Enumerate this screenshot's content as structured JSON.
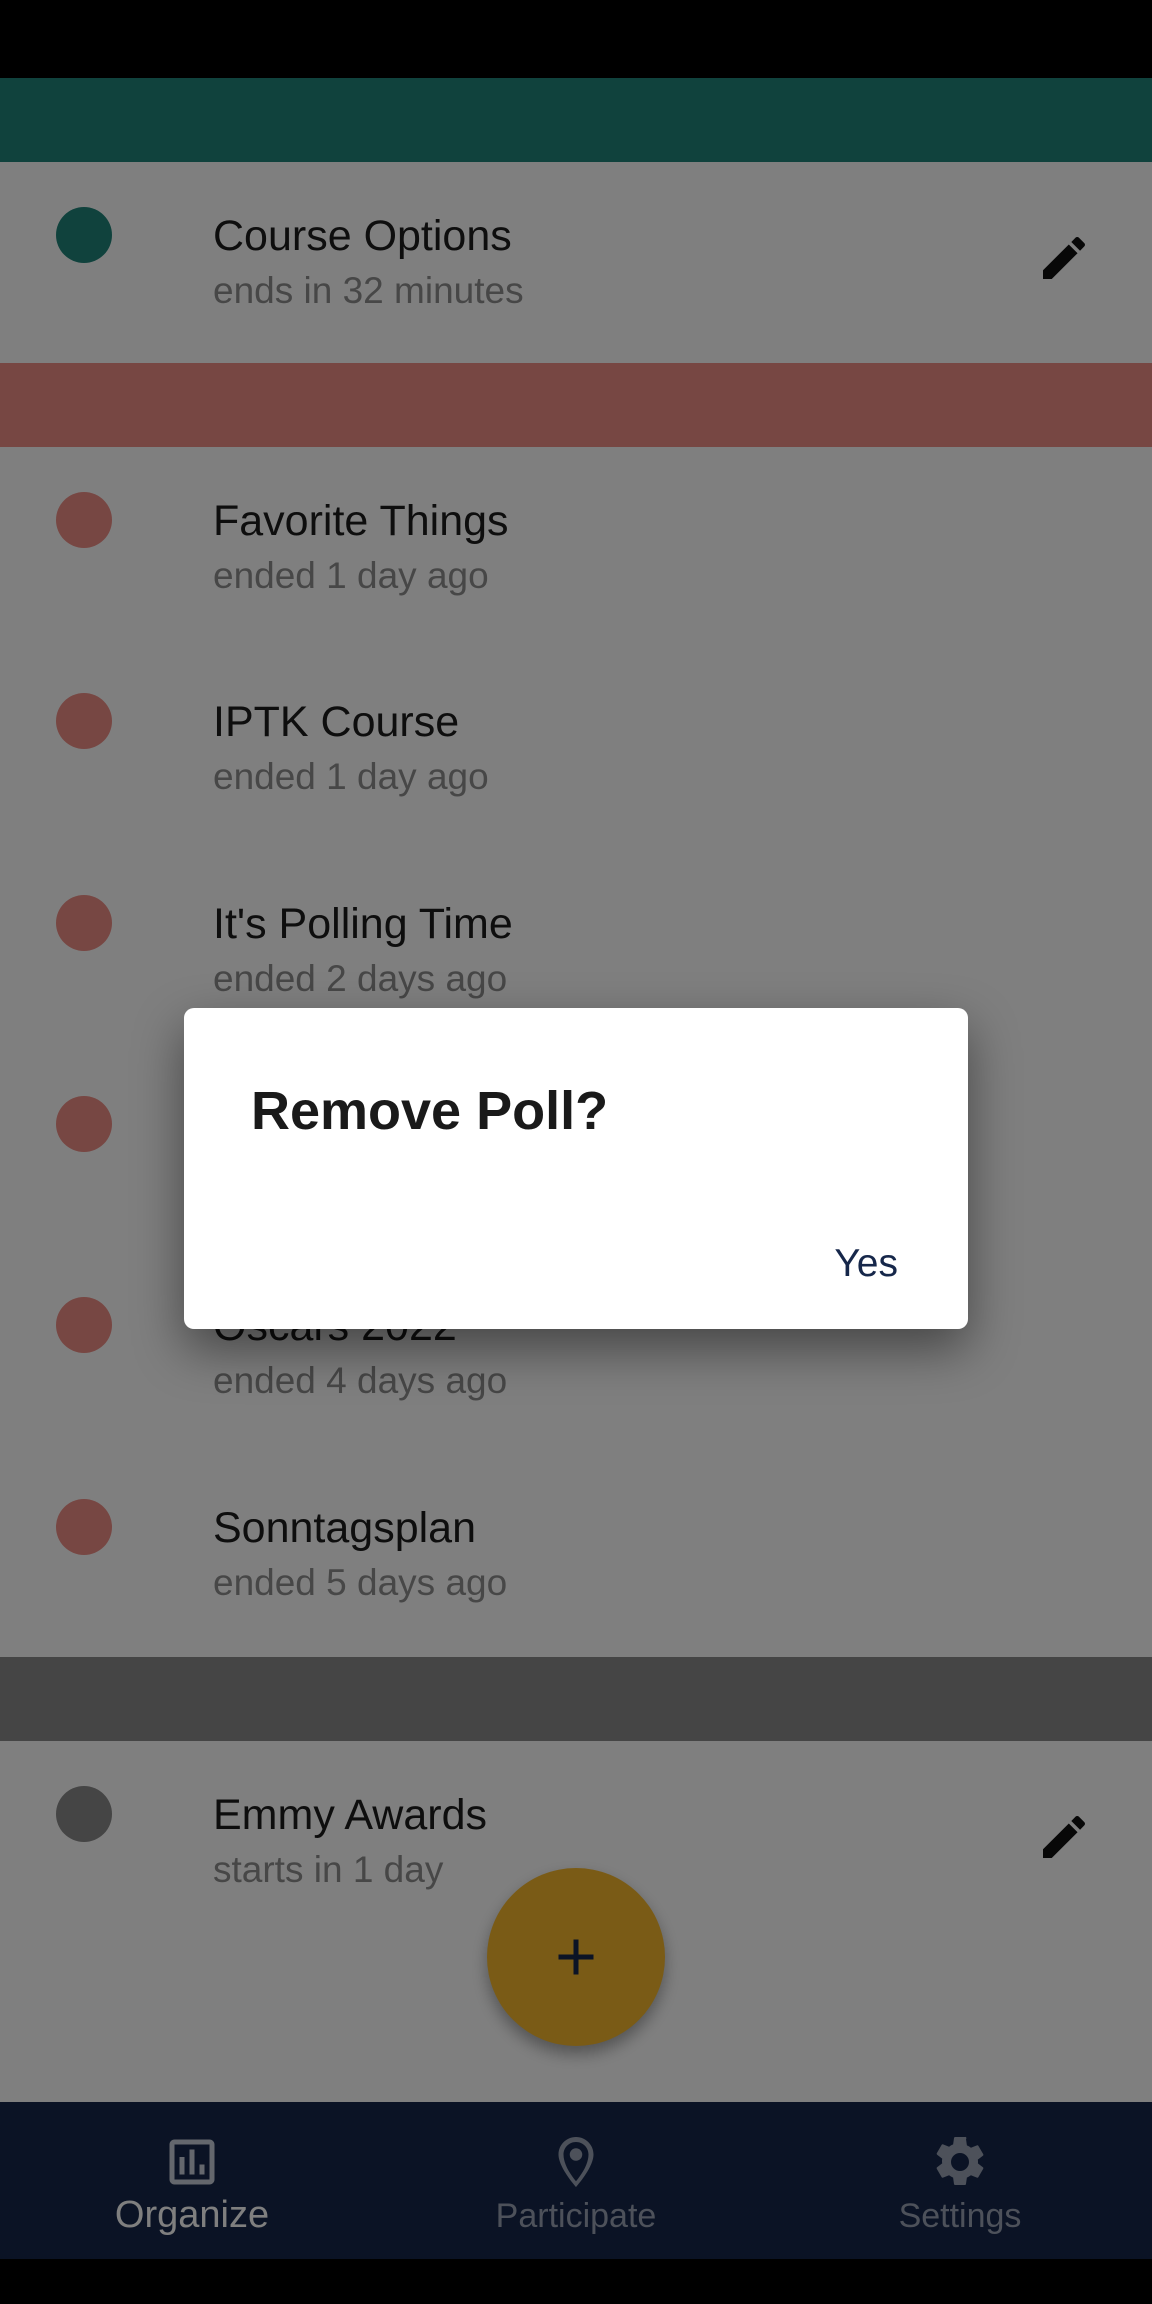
{
  "sections": {
    "active": {
      "color": "#20857a"
    },
    "ended": {
      "color": "#ef8e86"
    },
    "upcoming": {
      "color": "#8a8a8a"
    }
  },
  "polls": {
    "course_options": {
      "title": "Course Options",
      "status": "ends in 32 minutes"
    },
    "favorite_things": {
      "title": "Favorite Things",
      "status": "ended 1 day ago"
    },
    "iptk_course": {
      "title": "IPTK Course",
      "status": "ended 1 day ago"
    },
    "polling_time": {
      "title": "It's Polling Time",
      "status": "ended 2 days ago"
    },
    "oscars": {
      "title": "Oscars 2022",
      "status": "ended 4 days ago"
    },
    "sonntagsplan": {
      "title": "Sonntagsplan",
      "status": "ended 5 days ago"
    },
    "emmy_awards": {
      "title": "Emmy Awards",
      "status": "starts in 1 day"
    }
  },
  "icons": {
    "edit": "pencil-icon",
    "add": "plus-icon",
    "organize": "bar-chart-icon",
    "participate": "location-pin-icon",
    "settings": "gear-icon"
  },
  "fab": {
    "color": "#f4b72c"
  },
  "nav": {
    "organize_label": "Organize",
    "participate_label": "Participate",
    "settings_label": "Settings",
    "background": "#16274a"
  },
  "dialog": {
    "title": "Remove Poll?",
    "confirm_label": "Yes"
  }
}
